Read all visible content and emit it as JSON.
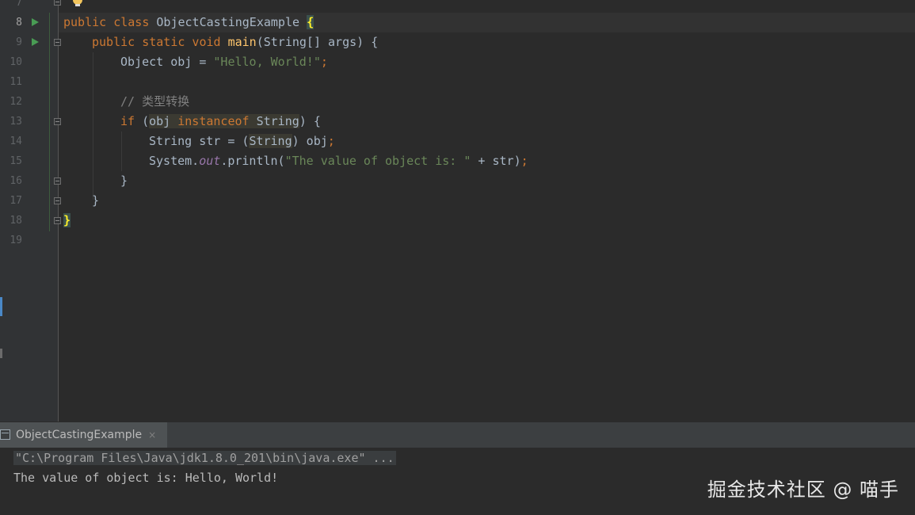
{
  "editor": {
    "line_numbers": [
      "7",
      "8",
      "9",
      "10",
      "11",
      "12",
      "13",
      "14",
      "15",
      "16",
      "17",
      "18",
      "19"
    ],
    "code": {
      "l8": {
        "kw1": "public class",
        "name": "ObjectCastingExample",
        "brace": "{"
      },
      "l9": {
        "kw1": "public static void",
        "fn": "main",
        "rest": "(String[] args) {"
      },
      "l10": {
        "pre": "Object obj = ",
        "str": "\"Hello, World!\"",
        "semi": ";"
      },
      "l12": {
        "comment": "// 类型转换"
      },
      "l13": {
        "kw": "if",
        "p1": " (",
        "obj": "obj",
        "kw2": "instanceof",
        "cls": "String",
        "p2": ") {"
      },
      "l14": {
        "pre": "String str = (",
        "cls": "String",
        "post": ") obj",
        "semi": ";"
      },
      "l15": {
        "pre": "System.",
        "field": "out",
        "mid": ".println(",
        "str": "\"The value of object is: \"",
        "post": " + str)",
        "semi": ";"
      },
      "l16": {
        "text": "}"
      },
      "l17": {
        "text": "}"
      },
      "l18": {
        "text": "}"
      }
    }
  },
  "run_panel": {
    "tab_label": "ObjectCastingExample",
    "close_glyph": "×"
  },
  "console": {
    "command": "\"C:\\Program Files\\Java\\jdk1.8.0_201\\bin\\java.exe\" ...",
    "output": "The value of object is: Hello, World!"
  },
  "watermark": "掘金技术社区 @ 喵手",
  "colors": {
    "background": "#2b2b2b",
    "keyword": "#cc7832",
    "string": "#6a8759",
    "method": "#ffc66d",
    "comment": "#808080",
    "run_icon": "#499c54"
  }
}
